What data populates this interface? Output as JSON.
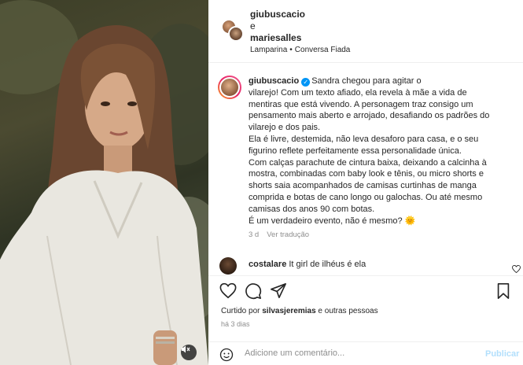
{
  "header": {
    "user1": "giubuscacio",
    "conjunction": "e",
    "user2": "mariesalles",
    "artist": "Lamparina",
    "dot": "•",
    "song": "Conversa Fiada"
  },
  "caption": {
    "username": "giubuscacio",
    "lines": [
      "Sandra chegou para agitar o",
      "vilarejo! Com um texto afiado, ela revela à mãe a vida de",
      "mentiras que está vivendo. A personagem traz consigo um",
      "pensamento mais aberto e arrojado, desafiando os padrões do",
      "vilarejo e dos pais.",
      "Ela é livre, destemida, não leva desaforo para casa, e o seu",
      "figurino reflete perfeitamente essa personalidade única.",
      "Com calças parachute de cintura baixa, deixando a calcinha à",
      "mostra, combinadas com baby look e tênis, ou micro shorts e",
      "shorts saia acompanhados de camisas curtinhas de manga",
      "comprida e botas de cano longo ou galochas. Ou até mesmo",
      "camisas dos anos 90 com botas.",
      "É um verdadeiro evento, não é mesmo? 🌞"
    ],
    "age": "3 d",
    "translate": "Ver tradução"
  },
  "comment": {
    "username": "costalare",
    "text": "It girl de ilhéus é ela"
  },
  "likes": {
    "prefix": "Curtido por",
    "user": "silvasjeremias",
    "suffix": "e outras pessoas"
  },
  "posted": "há 3 dias",
  "add_comment": {
    "placeholder": "Adicione um comentário...",
    "post": "Publicar"
  },
  "icons": {
    "verified": "verified-badge-icon",
    "heart": "heart-icon",
    "comment": "comment-icon",
    "share": "share-icon",
    "save": "bookmark-icon",
    "mute": "speaker-muted-icon",
    "emoji": "emoji-icon"
  },
  "colors": {
    "accent": "#0095f6",
    "post_disabled": "#b2dffc",
    "muted_text": "#8e8e8e"
  }
}
